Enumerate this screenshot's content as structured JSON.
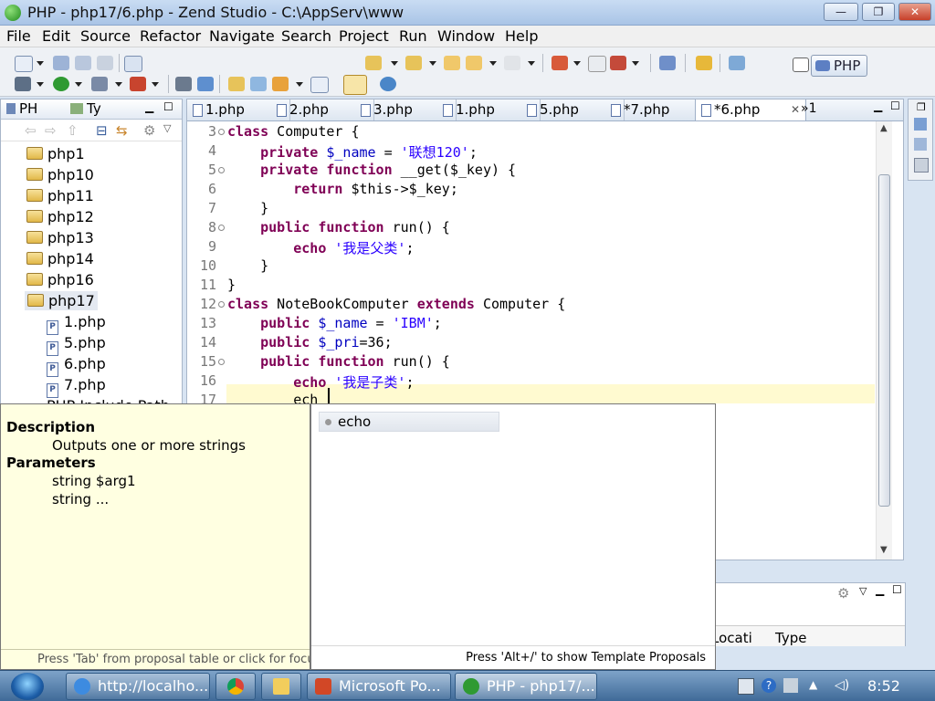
{
  "window": {
    "title": "PHP - php17/6.php - Zend Studio - C:\\AppServ\\www"
  },
  "menu": [
    "File",
    "Edit",
    "Source",
    "Refactor",
    "Navigate",
    "Search",
    "Project",
    "Run",
    "Window",
    "Help"
  ],
  "perspective": {
    "label": "PHP"
  },
  "left_panel": {
    "tabs": [
      "PH",
      "Ty"
    ],
    "tree": [
      "php1",
      "php10",
      "php11",
      "php12",
      "php13",
      "php14",
      "php16",
      "php17"
    ],
    "files": [
      "1.php",
      "5.php",
      "6.php",
      "7.php"
    ],
    "partial": "PHP Include Path"
  },
  "editor": {
    "tabs": [
      "1.php",
      "2.php",
      "3.php",
      "1.php",
      "5.php",
      "*7.php",
      "*6.php"
    ],
    "overflow": "»1",
    "lines": [
      {
        "n": "3",
        "fold": true,
        "parts": [
          {
            "t": "class",
            "c": "kw"
          },
          {
            "t": " Computer {"
          }
        ]
      },
      {
        "n": "4",
        "parts": [
          {
            "t": "    "
          },
          {
            "t": "private",
            "c": "kw"
          },
          {
            "t": " "
          },
          {
            "t": "$_name",
            "c": "var"
          },
          {
            "t": " = "
          },
          {
            "t": "'联想120'",
            "c": "str"
          },
          {
            "t": ";"
          }
        ]
      },
      {
        "n": "5",
        "fold": true,
        "parts": [
          {
            "t": "    "
          },
          {
            "t": "private function",
            "c": "kw"
          },
          {
            "t": " __get($_key) {"
          }
        ]
      },
      {
        "n": "6",
        "parts": [
          {
            "t": "        "
          },
          {
            "t": "return",
            "c": "kw"
          },
          {
            "t": " $this->$_key;"
          }
        ]
      },
      {
        "n": "7",
        "parts": [
          {
            "t": "    }"
          }
        ]
      },
      {
        "n": "8",
        "fold": true,
        "parts": [
          {
            "t": "    "
          },
          {
            "t": "public function",
            "c": "kw"
          },
          {
            "t": " run() {"
          }
        ]
      },
      {
        "n": "9",
        "parts": [
          {
            "t": "        "
          },
          {
            "t": "echo",
            "c": "kw"
          },
          {
            "t": " "
          },
          {
            "t": "'我是父类'",
            "c": "str"
          },
          {
            "t": ";"
          }
        ]
      },
      {
        "n": "10",
        "parts": [
          {
            "t": "    }"
          }
        ]
      },
      {
        "n": "11",
        "parts": [
          {
            "t": "}"
          }
        ]
      },
      {
        "n": "12",
        "fold": true,
        "parts": [
          {
            "t": "class",
            "c": "kw"
          },
          {
            "t": " NoteBookComputer "
          },
          {
            "t": "extends",
            "c": "kw"
          },
          {
            "t": " Computer {"
          }
        ]
      },
      {
        "n": "13",
        "parts": [
          {
            "t": "    "
          },
          {
            "t": "public",
            "c": "kw"
          },
          {
            "t": " "
          },
          {
            "t": "$_name",
            "c": "var"
          },
          {
            "t": " = "
          },
          {
            "t": "'IBM'",
            "c": "str"
          },
          {
            "t": ";"
          }
        ]
      },
      {
        "n": "14",
        "parts": [
          {
            "t": "    "
          },
          {
            "t": "public",
            "c": "kw"
          },
          {
            "t": " "
          },
          {
            "t": "$_pri",
            "c": "var"
          },
          {
            "t": "=36;"
          }
        ]
      },
      {
        "n": "15",
        "fold": true,
        "parts": [
          {
            "t": "    "
          },
          {
            "t": "public function",
            "c": "kw"
          },
          {
            "t": " run() {"
          }
        ]
      },
      {
        "n": "16",
        "parts": [
          {
            "t": "        "
          },
          {
            "t": "echo",
            "c": "kw"
          },
          {
            "t": " "
          },
          {
            "t": "'我是子类'",
            "c": "str"
          },
          {
            "t": ";"
          }
        ]
      },
      {
        "n": "17",
        "parts": [
          {
            "t": "        ech"
          }
        ]
      }
    ]
  },
  "description_popup": {
    "heading": "Description",
    "text": "Outputs one or more strings",
    "params_heading": "Parameters",
    "param1": "string $arg1",
    "param2": "string ...",
    "footer": "Press 'Tab' from proposal table or click for focus"
  },
  "proposal_popup": {
    "item": "echo",
    "footer": "Press 'Alt+/' to show Template Proposals"
  },
  "bottom_panel": {
    "col1": "Locati",
    "col2": "Type"
  },
  "taskbar": {
    "tasks": [
      "http://localho...",
      "Microsoft Po...",
      "PHP - php17/..."
    ],
    "clock": "8:52"
  }
}
